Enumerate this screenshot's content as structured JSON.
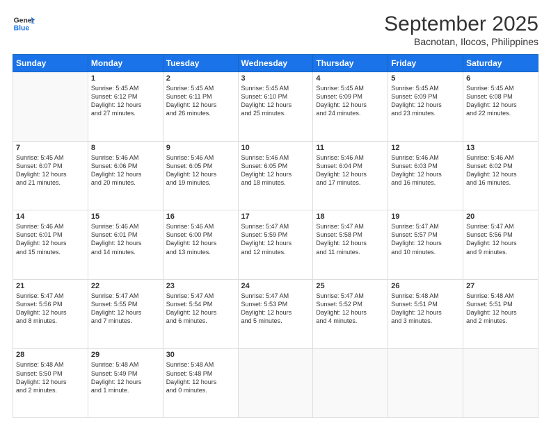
{
  "logo": {
    "line1": "General",
    "line2": "Blue"
  },
  "title": "September 2025",
  "subtitle": "Bacnotan, Ilocos, Philippines",
  "weekdays": [
    "Sunday",
    "Monday",
    "Tuesday",
    "Wednesday",
    "Thursday",
    "Friday",
    "Saturday"
  ],
  "weeks": [
    [
      {
        "day": "",
        "info": ""
      },
      {
        "day": "1",
        "info": "Sunrise: 5:45 AM\nSunset: 6:12 PM\nDaylight: 12 hours\nand 27 minutes."
      },
      {
        "day": "2",
        "info": "Sunrise: 5:45 AM\nSunset: 6:11 PM\nDaylight: 12 hours\nand 26 minutes."
      },
      {
        "day": "3",
        "info": "Sunrise: 5:45 AM\nSunset: 6:10 PM\nDaylight: 12 hours\nand 25 minutes."
      },
      {
        "day": "4",
        "info": "Sunrise: 5:45 AM\nSunset: 6:09 PM\nDaylight: 12 hours\nand 24 minutes."
      },
      {
        "day": "5",
        "info": "Sunrise: 5:45 AM\nSunset: 6:09 PM\nDaylight: 12 hours\nand 23 minutes."
      },
      {
        "day": "6",
        "info": "Sunrise: 5:45 AM\nSunset: 6:08 PM\nDaylight: 12 hours\nand 22 minutes."
      }
    ],
    [
      {
        "day": "7",
        "info": "Sunrise: 5:45 AM\nSunset: 6:07 PM\nDaylight: 12 hours\nand 21 minutes."
      },
      {
        "day": "8",
        "info": "Sunrise: 5:46 AM\nSunset: 6:06 PM\nDaylight: 12 hours\nand 20 minutes."
      },
      {
        "day": "9",
        "info": "Sunrise: 5:46 AM\nSunset: 6:05 PM\nDaylight: 12 hours\nand 19 minutes."
      },
      {
        "day": "10",
        "info": "Sunrise: 5:46 AM\nSunset: 6:05 PM\nDaylight: 12 hours\nand 18 minutes."
      },
      {
        "day": "11",
        "info": "Sunrise: 5:46 AM\nSunset: 6:04 PM\nDaylight: 12 hours\nand 17 minutes."
      },
      {
        "day": "12",
        "info": "Sunrise: 5:46 AM\nSunset: 6:03 PM\nDaylight: 12 hours\nand 16 minutes."
      },
      {
        "day": "13",
        "info": "Sunrise: 5:46 AM\nSunset: 6:02 PM\nDaylight: 12 hours\nand 16 minutes."
      }
    ],
    [
      {
        "day": "14",
        "info": "Sunrise: 5:46 AM\nSunset: 6:01 PM\nDaylight: 12 hours\nand 15 minutes."
      },
      {
        "day": "15",
        "info": "Sunrise: 5:46 AM\nSunset: 6:01 PM\nDaylight: 12 hours\nand 14 minutes."
      },
      {
        "day": "16",
        "info": "Sunrise: 5:46 AM\nSunset: 6:00 PM\nDaylight: 12 hours\nand 13 minutes."
      },
      {
        "day": "17",
        "info": "Sunrise: 5:47 AM\nSunset: 5:59 PM\nDaylight: 12 hours\nand 12 minutes."
      },
      {
        "day": "18",
        "info": "Sunrise: 5:47 AM\nSunset: 5:58 PM\nDaylight: 12 hours\nand 11 minutes."
      },
      {
        "day": "19",
        "info": "Sunrise: 5:47 AM\nSunset: 5:57 PM\nDaylight: 12 hours\nand 10 minutes."
      },
      {
        "day": "20",
        "info": "Sunrise: 5:47 AM\nSunset: 5:56 PM\nDaylight: 12 hours\nand 9 minutes."
      }
    ],
    [
      {
        "day": "21",
        "info": "Sunrise: 5:47 AM\nSunset: 5:56 PM\nDaylight: 12 hours\nand 8 minutes."
      },
      {
        "day": "22",
        "info": "Sunrise: 5:47 AM\nSunset: 5:55 PM\nDaylight: 12 hours\nand 7 minutes."
      },
      {
        "day": "23",
        "info": "Sunrise: 5:47 AM\nSunset: 5:54 PM\nDaylight: 12 hours\nand 6 minutes."
      },
      {
        "day": "24",
        "info": "Sunrise: 5:47 AM\nSunset: 5:53 PM\nDaylight: 12 hours\nand 5 minutes."
      },
      {
        "day": "25",
        "info": "Sunrise: 5:47 AM\nSunset: 5:52 PM\nDaylight: 12 hours\nand 4 minutes."
      },
      {
        "day": "26",
        "info": "Sunrise: 5:48 AM\nSunset: 5:51 PM\nDaylight: 12 hours\nand 3 minutes."
      },
      {
        "day": "27",
        "info": "Sunrise: 5:48 AM\nSunset: 5:51 PM\nDaylight: 12 hours\nand 2 minutes."
      }
    ],
    [
      {
        "day": "28",
        "info": "Sunrise: 5:48 AM\nSunset: 5:50 PM\nDaylight: 12 hours\nand 2 minutes."
      },
      {
        "day": "29",
        "info": "Sunrise: 5:48 AM\nSunset: 5:49 PM\nDaylight: 12 hours\nand 1 minute."
      },
      {
        "day": "30",
        "info": "Sunrise: 5:48 AM\nSunset: 5:48 PM\nDaylight: 12 hours\nand 0 minutes."
      },
      {
        "day": "",
        "info": ""
      },
      {
        "day": "",
        "info": ""
      },
      {
        "day": "",
        "info": ""
      },
      {
        "day": "",
        "info": ""
      }
    ]
  ]
}
